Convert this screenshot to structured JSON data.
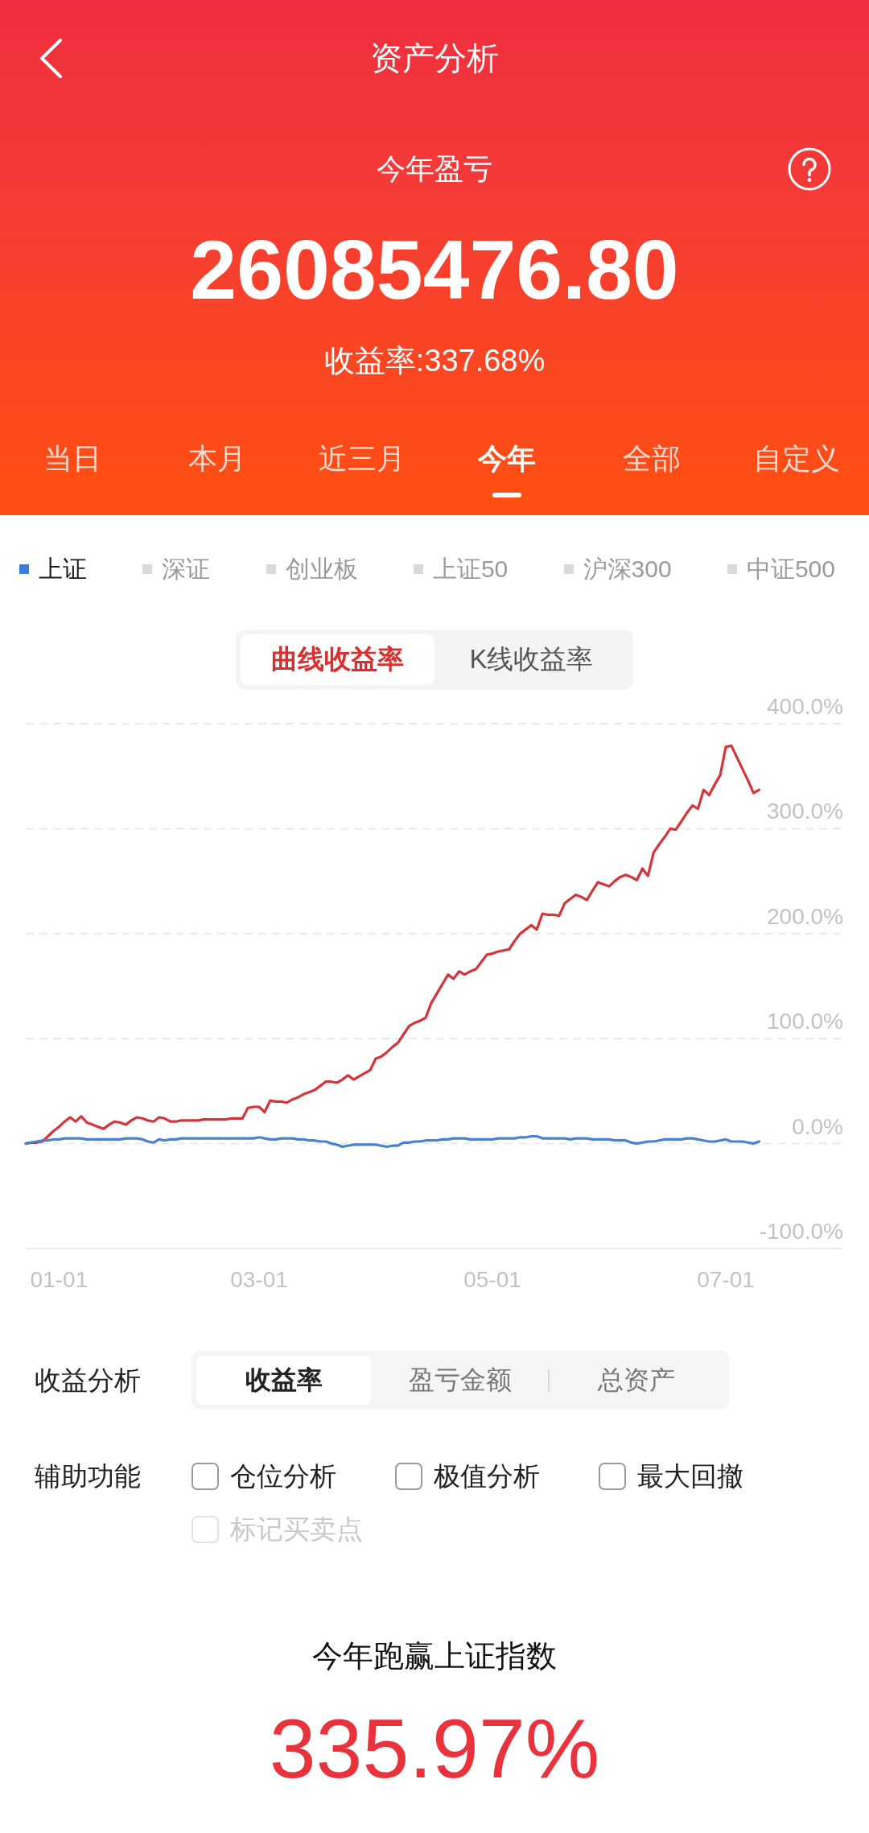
{
  "nav": {
    "title": "资产分析"
  },
  "summary": {
    "label": "今年盈亏",
    "amount": "26085476.80",
    "rate": "收益率:337.68%"
  },
  "period_tabs": [
    {
      "label": "当日",
      "selected": false
    },
    {
      "label": "本月",
      "selected": false
    },
    {
      "label": "近三月",
      "selected": false
    },
    {
      "label": "今年",
      "selected": true
    },
    {
      "label": "全部",
      "selected": false
    },
    {
      "label": "自定义",
      "selected": false
    }
  ],
  "indices": [
    {
      "label": "上证",
      "selected": true
    },
    {
      "label": "深证",
      "selected": false
    },
    {
      "label": "创业板",
      "selected": false
    },
    {
      "label": "上证50",
      "selected": false
    },
    {
      "label": "沪深300",
      "selected": false
    },
    {
      "label": "中证500",
      "selected": false
    }
  ],
  "chart_modes": [
    {
      "label": "曲线收益率",
      "selected": true
    },
    {
      "label": "K线收益率",
      "selected": false
    }
  ],
  "chart": {
    "chart_data": {
      "type": "line",
      "categories": [
        null,
        null,
        null,
        null,
        null,
        null,
        "01-01",
        null,
        null,
        null,
        null,
        null,
        null,
        null,
        null,
        null,
        null,
        null,
        null,
        null,
        null,
        null,
        null,
        null,
        null,
        null,
        null,
        null,
        null,
        null,
        null,
        null,
        null,
        null,
        null,
        null,
        null,
        null,
        null,
        null,
        null,
        null,
        "03-01",
        null,
        null,
        null,
        null,
        null,
        null,
        null,
        null,
        null,
        null,
        null,
        null,
        null,
        null,
        null,
        null,
        null,
        null,
        null,
        null,
        null,
        null,
        null,
        null,
        null,
        null,
        null,
        null,
        null,
        null,
        null,
        null,
        null,
        null,
        null,
        null,
        null,
        null,
        null,
        null,
        null,
        "05-01",
        null,
        null,
        null,
        null,
        null,
        null,
        null,
        null,
        null,
        null,
        null,
        null,
        null,
        null,
        null,
        null,
        null,
        null,
        null,
        null,
        null,
        null,
        null,
        null,
        null,
        null,
        null,
        null,
        null,
        null,
        null,
        null,
        null,
        null,
        null,
        null,
        null,
        null,
        null,
        null,
        null,
        "07-01",
        null,
        null,
        null,
        null,
        null,
        null,
        null,
        null,
        null,
        null,
        null,
        null,
        null,
        null,
        null,
        null,
        null,
        null,
        null,
        null,
        null
      ],
      "series": [
        {
          "color": "#d2363b",
          "values": [
            0,
            1,
            1,
            2,
            7,
            12,
            16,
            21,
            25,
            21,
            26,
            20,
            18,
            16,
            14,
            18,
            21,
            20,
            18,
            22,
            25,
            24,
            22,
            21,
            25,
            24,
            21,
            21,
            22,
            22,
            22,
            22,
            23,
            23,
            23,
            23,
            23,
            24,
            24,
            24,
            34,
            35,
            35,
            30,
            41,
            40,
            40,
            39,
            42,
            44,
            47,
            49,
            51,
            55,
            59,
            59,
            58,
            61,
            65,
            61,
            64,
            67,
            70,
            81,
            83,
            87,
            92,
            96,
            104,
            112,
            115,
            117,
            120,
            134,
            143,
            152,
            161,
            157,
            164,
            161,
            164,
            166,
            173,
            180,
            181,
            183,
            184,
            185,
            193,
            200,
            204,
            208,
            204,
            219,
            218,
            218,
            217,
            229,
            233,
            237,
            235,
            232,
            241,
            249,
            247,
            245,
            250,
            254,
            256,
            254,
            251,
            262,
            255,
            277,
            285,
            292,
            300,
            299,
            307,
            315,
            322,
            319,
            337,
            332,
            342,
            351,
            378,
            379,
            368,
            357,
            346,
            334,
            337,
            null,
            null,
            null,
            null,
            null,
            null,
            null,
            null,
            null,
            null,
            null,
            null,
            null,
            null,
            null
          ]
        },
        {
          "color": "#4a80d0",
          "values": [
            0,
            1,
            2,
            3,
            3,
            4,
            4,
            5,
            5,
            5,
            5,
            4,
            4,
            4,
            4,
            4,
            4,
            4,
            5,
            5,
            5,
            4,
            2,
            1,
            4,
            3,
            4,
            4,
            5,
            5,
            5,
            5,
            5,
            5,
            5,
            5,
            5,
            5,
            5,
            5,
            5,
            5,
            6,
            5,
            4,
            4,
            5,
            5,
            5,
            4,
            4,
            3,
            3,
            2,
            2,
            0,
            -1,
            -3,
            -2,
            -1,
            -1,
            -1,
            -1,
            -1,
            -2,
            -3,
            -2,
            -2,
            1,
            1,
            2,
            2,
            3,
            3,
            3,
            4,
            4,
            5,
            5,
            5,
            4,
            4,
            4,
            4,
            4,
            5,
            5,
            5,
            5,
            6,
            6,
            7,
            7,
            5,
            5,
            5,
            5,
            5,
            4,
            5,
            5,
            5,
            4,
            4,
            4,
            4,
            3,
            3,
            3,
            1,
            0,
            1,
            2,
            2,
            3,
            4,
            4,
            4,
            4,
            5,
            5,
            4,
            3,
            2,
            2,
            3,
            4,
            2,
            2,
            2,
            1,
            0,
            2,
            null,
            null,
            null,
            null,
            null,
            null,
            null,
            null,
            null,
            null,
            null,
            null,
            null,
            null,
            null
          ]
        }
      ],
      "ylim": [
        -100,
        400
      ],
      "grid": true,
      "yticks": [
        {
          "value": -100,
          "label": "-100.0%"
        },
        {
          "value": 0,
          "label": "0.0%"
        },
        {
          "value": 100,
          "label": "100.0%"
        },
        {
          "value": 200,
          "label": "200.0%"
        },
        {
          "value": 300,
          "label": "300.0%"
        },
        {
          "value": 400,
          "label": "400.0%"
        }
      ]
    }
  },
  "profit_analysis": {
    "label": "收益分析",
    "options": [
      {
        "label": "收益率",
        "selected": true
      },
      {
        "label": "盈亏金额",
        "selected": false
      },
      {
        "label": "总资产",
        "selected": false
      }
    ]
  },
  "aux_functions": {
    "label": "辅助功能",
    "options": [
      {
        "label": "仓位分析",
        "checked": false,
        "disabled": false
      },
      {
        "label": "极值分析",
        "checked": false,
        "disabled": false
      },
      {
        "label": "最大回撤",
        "checked": false,
        "disabled": false
      },
      {
        "label": "标记买卖点",
        "checked": false,
        "disabled": true
      }
    ]
  },
  "outperformance": {
    "label": "今年跑赢上证指数",
    "value": "335.97%"
  }
}
